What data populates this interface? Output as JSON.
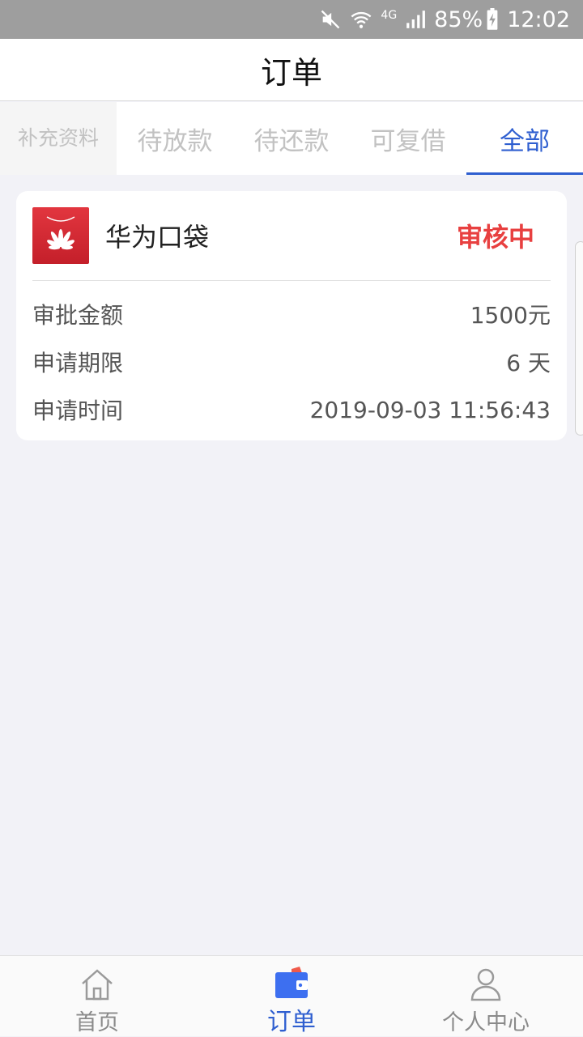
{
  "status_bar": {
    "network": "4G",
    "battery": "85%",
    "time": "12:02"
  },
  "header": {
    "title": "订单"
  },
  "tabs": [
    {
      "label": "补充资料"
    },
    {
      "label": "待放款"
    },
    {
      "label": "待还款"
    },
    {
      "label": "可复借"
    },
    {
      "label": "全部"
    }
  ],
  "order": {
    "product_name": "华为口袋",
    "status": "审核中",
    "rows": [
      {
        "label": "审批金额",
        "value": "1500元"
      },
      {
        "label": "申请期限",
        "value": "6 天"
      },
      {
        "label": "申请时间",
        "value": "2019-09-03 11:56:43"
      }
    ]
  },
  "bottom_nav": [
    {
      "label": "首页",
      "icon": "home-icon"
    },
    {
      "label": "订单",
      "icon": "wallet-icon"
    },
    {
      "label": "个人中心",
      "icon": "person-icon"
    }
  ],
  "colors": {
    "accent": "#2f5fd0",
    "status_red": "#e84040",
    "brand_red": "#d62b35"
  }
}
